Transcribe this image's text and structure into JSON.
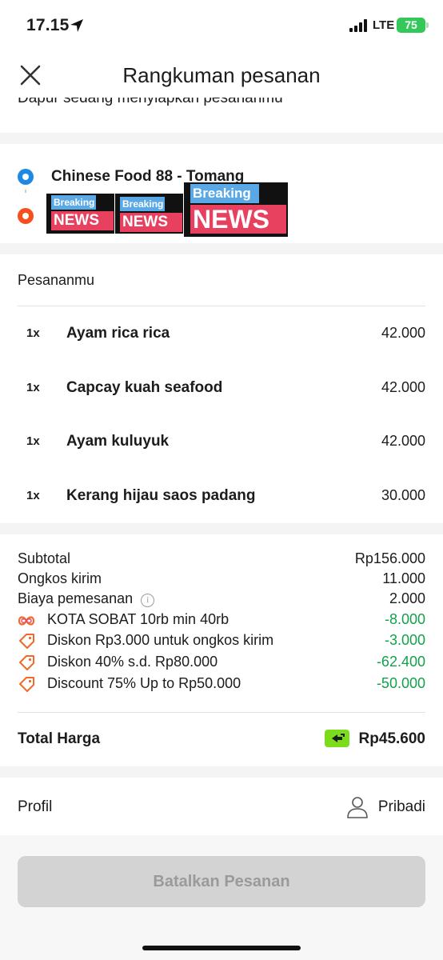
{
  "status_bar": {
    "time": "17.15",
    "network": "LTE",
    "battery": "75"
  },
  "header": {
    "title": "Rangkuman pesanan"
  },
  "subtitle": "Dapur sedang menyiapkan pesananmu",
  "route": {
    "restaurant": "Chinese Food 88 - Tomang",
    "sticker_small_top": "Breaking",
    "sticker_small_bottom": "NEWS",
    "sticker_large_top": "Breaking",
    "sticker_large_bottom": "NEWS"
  },
  "orders": {
    "heading": "Pesananmu",
    "items": [
      {
        "qty": "1x",
        "name": "Ayam rica rica",
        "price": "42.000"
      },
      {
        "qty": "1x",
        "name": "Capcay kuah seafood",
        "price": "42.000"
      },
      {
        "qty": "1x",
        "name": "Ayam kuluyuk",
        "price": "42.000"
      },
      {
        "qty": "1x",
        "name": "Kerang hijau saos padang",
        "price": "30.000"
      }
    ]
  },
  "summary": {
    "subtotal_label": "Subtotal",
    "subtotal_value": "Rp156.000",
    "delivery_label": "Ongkos kirim",
    "delivery_value": "11.000",
    "fee_label": "Biaya pemesanan",
    "fee_value": "2.000",
    "vouchers": [
      {
        "label": "KOTA SOBAT 10rb min 40rb",
        "value": "-8.000",
        "icon": "infinity-badge-icon"
      },
      {
        "label": "Diskon Rp3.000 untuk ongkos kirim",
        "value": "-3.000",
        "icon": "tag-icon"
      },
      {
        "label": "Diskon 40% s.d. Rp80.000",
        "value": "-62.400",
        "icon": "tag-icon"
      },
      {
        "label": "Discount 75% Up to Rp50.000",
        "value": "-50.000",
        "icon": "tag-icon"
      }
    ],
    "total_label": "Total Harga",
    "total_value": "Rp45.600"
  },
  "profile": {
    "label": "Profil",
    "value": "Pribadi"
  },
  "cancel_button": "Batalkan Pesanan",
  "colors": {
    "discount_green": "#12a14b",
    "pay_badge": "#7bdc1b",
    "origin_dot": "#1e88e5",
    "destination_dot": "#f4511e"
  }
}
